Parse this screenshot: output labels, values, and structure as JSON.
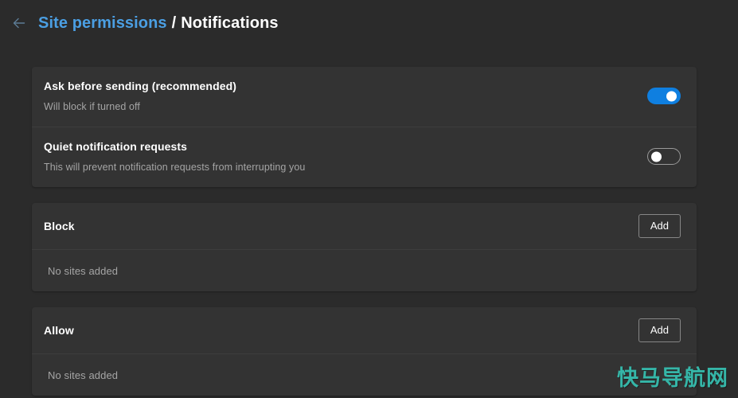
{
  "header": {
    "back_icon": "arrow-left-icon",
    "breadcrumb_parent": "Site permissions",
    "breadcrumb_separator": "/",
    "breadcrumb_current": "Notifications"
  },
  "settings": [
    {
      "title": "Ask before sending (recommended)",
      "description": "Will block if turned off",
      "toggle_state": "on"
    },
    {
      "title": "Quiet notification requests",
      "description": "This will prevent notification requests from interrupting you",
      "toggle_state": "off"
    }
  ],
  "lists": [
    {
      "title": "Block",
      "add_label": "Add",
      "empty_text": "No sites added"
    },
    {
      "title": "Allow",
      "add_label": "Add",
      "empty_text": "No sites added"
    }
  ],
  "watermark": "快马导航网",
  "colors": {
    "page_bg": "#2b2b2b",
    "card_bg": "#333333",
    "accent_link": "#4b9fe3",
    "toggle_on": "#0f7fe0",
    "muted_text": "#a5a5a5",
    "watermark": "#35b6a8"
  }
}
